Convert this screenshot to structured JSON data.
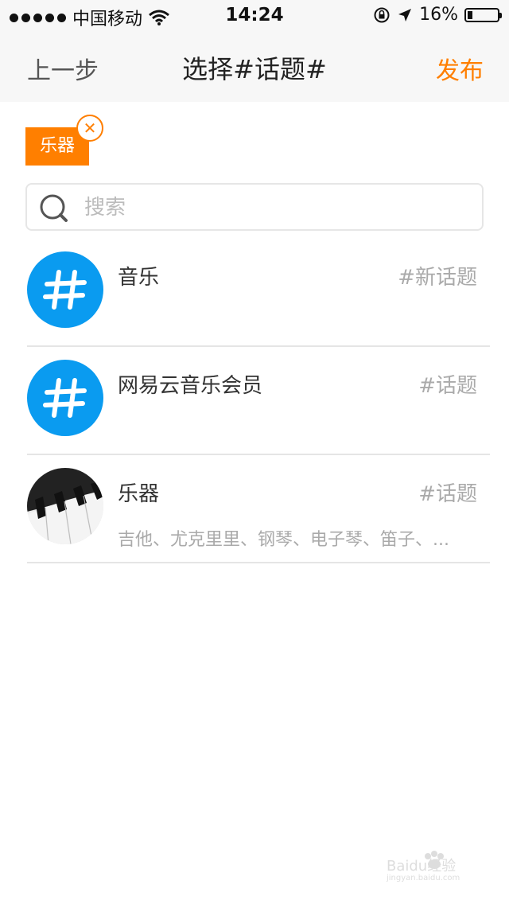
{
  "status_bar": {
    "carrier": "中国移动",
    "time": "14:24",
    "battery_percent": "16%",
    "battery_level": 0.16,
    "icons": [
      "signal-dots-icon",
      "wifi-icon",
      "rotation-lock-icon",
      "location-arrow-icon",
      "battery-icon"
    ]
  },
  "nav": {
    "back_label": "上一步",
    "title": "选择#话题#",
    "publish_label": "发布"
  },
  "selected_tags": [
    {
      "label": "乐器",
      "remove_icon": "close-icon"
    }
  ],
  "search": {
    "placeholder": "搜索",
    "value": ""
  },
  "topics": [
    {
      "name": "音乐",
      "type": "#新话题",
      "subtitle": "",
      "avatar": "hashtag-icon"
    },
    {
      "name": "网易云音乐会员",
      "type": "#话题",
      "subtitle": "",
      "avatar": "hashtag-icon"
    },
    {
      "name": "乐器",
      "type": "#话题",
      "subtitle": "吉他、尤克里里、钢琴、电子琴、笛子、...",
      "avatar": "piano-keys-image"
    }
  ],
  "colors": {
    "accent": "#ff7f00",
    "topic_avatar_blue": "#0a9bf0",
    "nav_background": "#f7f7f7"
  },
  "watermark": {
    "brand": "Baidu经验",
    "url": "jingyan.baidu.com"
  }
}
